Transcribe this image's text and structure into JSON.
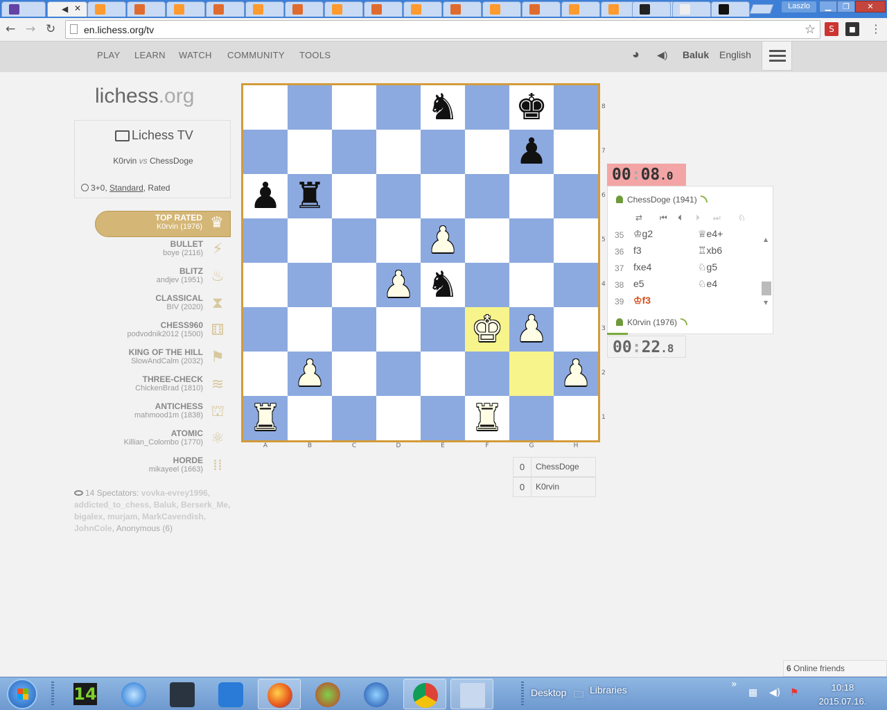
{
  "browser": {
    "window_user": "Laszlo",
    "url": "en.lichess.org/tv",
    "tab_count": 19
  },
  "header": {
    "nav": [
      "PLAY",
      "LEARN",
      "WATCH",
      "COMMUNITY",
      "TOOLS"
    ],
    "username": "Baluk",
    "language": "English"
  },
  "sidebar": {
    "logo_main": "lichess",
    "logo_tld": ".org",
    "tv_title": "Lichess TV",
    "white_player": "K0rvin",
    "vs": "vs",
    "black_player": "ChessDoge",
    "time_control": "3+0,",
    "variant": "Standard",
    "rated": ", Rated",
    "channels": [
      {
        "name": "TOP RATED",
        "player": "K0rvin (1976)",
        "icon": "crown-icon",
        "glyph": "♛",
        "active": true
      },
      {
        "name": "BULLET",
        "player": "boye (2116)",
        "icon": "bolt-icon",
        "glyph": "⚡",
        "active": false
      },
      {
        "name": "BLITZ",
        "player": "andjev (1951)",
        "icon": "fire-icon",
        "glyph": "♨",
        "active": false
      },
      {
        "name": "CLASSICAL",
        "player": "BIV (2020)",
        "icon": "hourglass-icon",
        "glyph": "⧗",
        "active": false
      },
      {
        "name": "CHESS960",
        "player": "podvodnik2012 (1500)",
        "icon": "dice-icon",
        "glyph": "⚅",
        "active": false
      },
      {
        "name": "KING OF THE HILL",
        "player": "SlowAndCalm (2032)",
        "icon": "flag-icon",
        "glyph": "⚑",
        "active": false
      },
      {
        "name": "THREE-CHECK",
        "player": "ChickenBrad (1810)",
        "icon": "stack-icon",
        "glyph": "≋",
        "active": false
      },
      {
        "name": "ANTICHESS",
        "player": "mahmood1m (1838)",
        "icon": "mushroom-icon",
        "glyph": "⛫",
        "active": false
      },
      {
        "name": "ATOMIC",
        "player": "Killian_Colombo (1770)",
        "icon": "atom-icon",
        "glyph": "⚛",
        "active": false
      },
      {
        "name": "HORDE",
        "player": "mikayeel (1663)",
        "icon": "grid-icon",
        "glyph": "⁞⁞",
        "active": false
      }
    ],
    "spectators_label": "14 Spectators:",
    "spectators_names": "vovka-evrey1996, addicted_to_chess, Baluk, Berserk_Me, bigalex, murjam, MarkCavendish, JohnCole,",
    "spectators_anon": "Anonymous (6)"
  },
  "board": {
    "files": [
      "A",
      "B",
      "C",
      "D",
      "E",
      "F",
      "G",
      "H"
    ],
    "ranks": [
      "8",
      "7",
      "6",
      "5",
      "4",
      "3",
      "2",
      "1"
    ],
    "highlight": [
      "f3",
      "g2"
    ],
    "pieces": [
      {
        "sq": "e8",
        "color": "b",
        "type": "knight",
        "glyph": "♞"
      },
      {
        "sq": "g8",
        "color": "b",
        "type": "king",
        "glyph": "♚"
      },
      {
        "sq": "g7",
        "color": "b",
        "type": "pawn",
        "glyph": "♟"
      },
      {
        "sq": "a6",
        "color": "b",
        "type": "pawn",
        "glyph": "♟"
      },
      {
        "sq": "b6",
        "color": "b",
        "type": "rook",
        "glyph": "♜"
      },
      {
        "sq": "e5",
        "color": "w",
        "type": "pawn",
        "glyph": "♟"
      },
      {
        "sq": "d4",
        "color": "w",
        "type": "pawn",
        "glyph": "♟"
      },
      {
        "sq": "e4",
        "color": "b",
        "type": "knight",
        "glyph": "♞"
      },
      {
        "sq": "f3",
        "color": "w",
        "type": "king",
        "glyph": "♚"
      },
      {
        "sq": "g3",
        "color": "w",
        "type": "pawn",
        "glyph": "♟"
      },
      {
        "sq": "b2",
        "color": "w",
        "type": "pawn",
        "glyph": "♟"
      },
      {
        "sq": "h2",
        "color": "w",
        "type": "pawn",
        "glyph": "♟"
      },
      {
        "sq": "a1",
        "color": "w",
        "type": "rook",
        "glyph": "♜"
      },
      {
        "sq": "f1",
        "color": "w",
        "type": "rook",
        "glyph": "♜"
      }
    ]
  },
  "game": {
    "top_clock": {
      "main": "00",
      "colon": ":",
      "sec": "08",
      "tenth": ".0"
    },
    "bottom_clock": {
      "main": "00",
      "colon": ":",
      "sec": "22",
      "tenth": ".8"
    },
    "top_player": "ChessDoge (1941)",
    "bottom_player": "K0rvin (1976)",
    "moves": [
      {
        "num": "35",
        "white": "♔g2",
        "black": "♕e4+"
      },
      {
        "num": "36",
        "white": "f3",
        "black": "♖xb6"
      },
      {
        "num": "37",
        "white": "fxe4",
        "black": "♘g5"
      },
      {
        "num": "38",
        "white": "e5",
        "black": "♘e4"
      },
      {
        "num": "39",
        "white": "♔f3",
        "black": ""
      }
    ],
    "scores": [
      {
        "points": "0",
        "player": "ChessDoge"
      },
      {
        "points": "0",
        "player": "K0rvin"
      }
    ]
  },
  "friends": {
    "count": "6",
    "label": " Online friends"
  },
  "taskbar": {
    "desktop_label": "Desktop",
    "libraries_label": "Libraries",
    "time": "10:18",
    "date": "2015.07.16.",
    "app_14_label": "14"
  }
}
